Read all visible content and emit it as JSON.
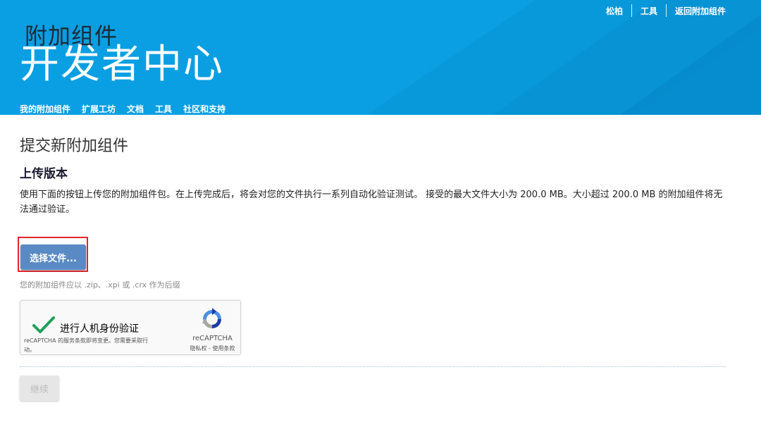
{
  "header": {
    "top_links": [
      "松柏",
      "工具",
      "返回附加组件"
    ],
    "subtitle": "附加组件",
    "title": "开发者中心",
    "nav": [
      "我的附加组件",
      "扩展工坊",
      "文档",
      "工具",
      "社区和支持"
    ]
  },
  "main": {
    "page_title": "提交新附加组件",
    "section_title": "上传版本",
    "description": "使用下面的按钮上传您的附加组件包。在上传完成后，将会对您的文件执行一系列自动化验证测试。 接受的最大文件大小为 200.0 MB。大小超过 200.0 MB 的附加组件将无法通过验证。",
    "upload_button": "选择文件...",
    "upload_hint": "您的附加组件应以 .zip、.xpi 或 .crx 作为后缀",
    "recaptcha": {
      "label": "进行人机身份验证",
      "terms": "reCAPTCHA 的服务条款即将变更。您需要采取行动。",
      "brand": "reCAPTCHA",
      "links": "隐私权 - 使用条款"
    },
    "continue_button": "继续"
  },
  "colors": {
    "header_bg": "#0a9fe3",
    "primary_button": "#5a8ac4",
    "highlight_border": "#e3262e",
    "check": "#21a05a"
  }
}
